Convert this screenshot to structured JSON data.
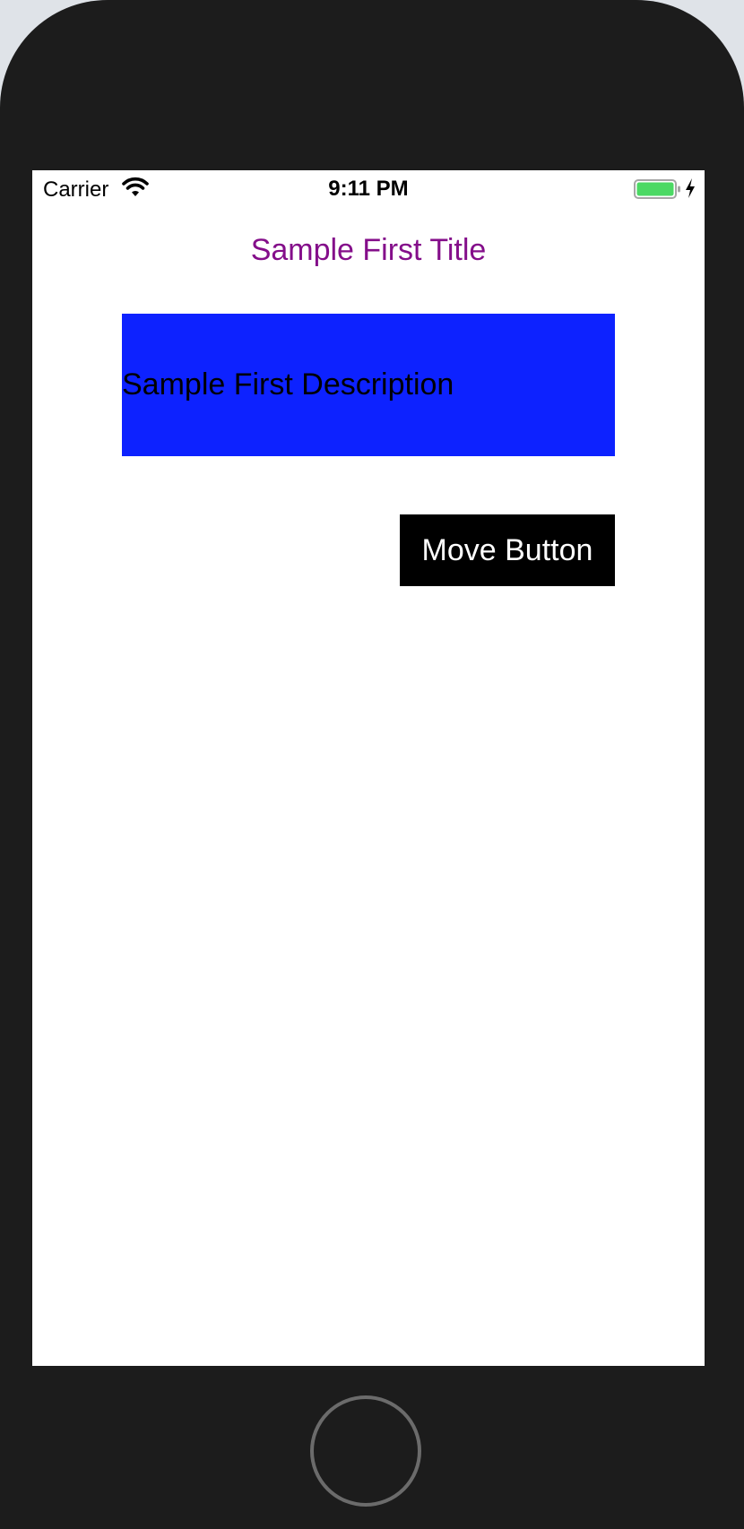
{
  "status_bar": {
    "carrier": "Carrier",
    "time": "9:11 PM",
    "battery_color": "#4cd964"
  },
  "screen": {
    "title": "Sample First Title",
    "title_color": "#840e8a",
    "description": "Sample First Description",
    "description_bg": "#0d22ff",
    "button_label": "Move Button"
  },
  "icons": {
    "wifi": "wifi-icon",
    "battery": "battery-icon",
    "charging": "charging-bolt-icon",
    "home": "home-button"
  }
}
